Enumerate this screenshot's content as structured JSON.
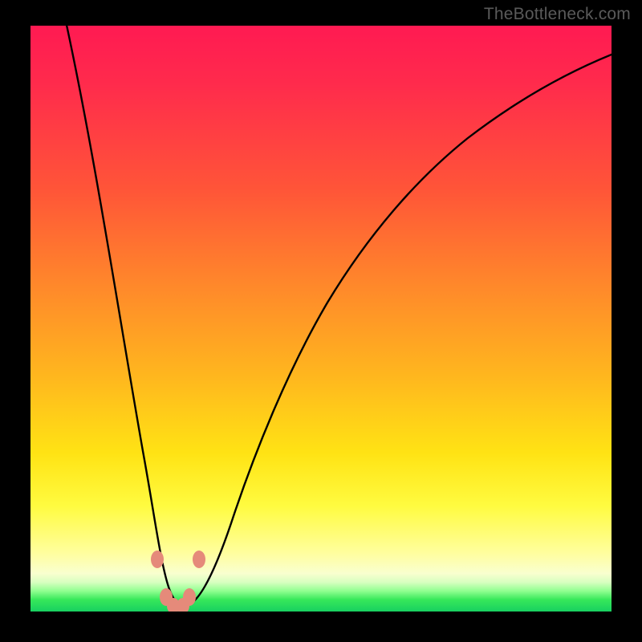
{
  "watermark": "TheBottleneck.com",
  "colors": {
    "frame": "#000000",
    "gradient_top": "#ff1a52",
    "gradient_mid": "#ffe314",
    "gradient_bottom": "#18d060",
    "curve": "#000000",
    "marker_fill": "#e58a7a",
    "marker_stroke": "#b83d2f",
    "watermark": "#5a5a5a"
  },
  "chart_data": {
    "type": "line",
    "title": "",
    "xlabel": "",
    "ylabel": "",
    "x": [
      0.06,
      0.1,
      0.15,
      0.2,
      0.215,
      0.23,
      0.245,
      0.26,
      0.28,
      0.3,
      0.35,
      0.4,
      0.45,
      0.5,
      0.55,
      0.6,
      0.65,
      0.7,
      0.75,
      0.8,
      0.85,
      0.9,
      0.95,
      1.0
    ],
    "values": [
      100,
      78,
      50,
      20,
      10,
      3,
      0,
      0,
      3,
      10,
      28,
      42,
      52,
      60,
      66,
      71,
      75,
      78.5,
      81.5,
      84,
      86,
      87.7,
      89.2,
      90.5
    ],
    "xlim": [
      0,
      1
    ],
    "ylim": [
      0,
      100
    ],
    "note": "x is normalized horizontal position; values are bottleneck percentage read from vertical gradient (0 = green bottom, 100 = red top). Curve minimum near x≈0.25.",
    "markers": [
      {
        "x": 0.218,
        "y_pct": 9
      },
      {
        "x": 0.29,
        "y_pct": 9
      },
      {
        "x": 0.232,
        "y_pct": 2.2
      },
      {
        "x": 0.273,
        "y_pct": 2.2
      },
      {
        "x": 0.245,
        "y_pct": 0.9
      },
      {
        "x": 0.26,
        "y_pct": 0.9
      }
    ]
  }
}
